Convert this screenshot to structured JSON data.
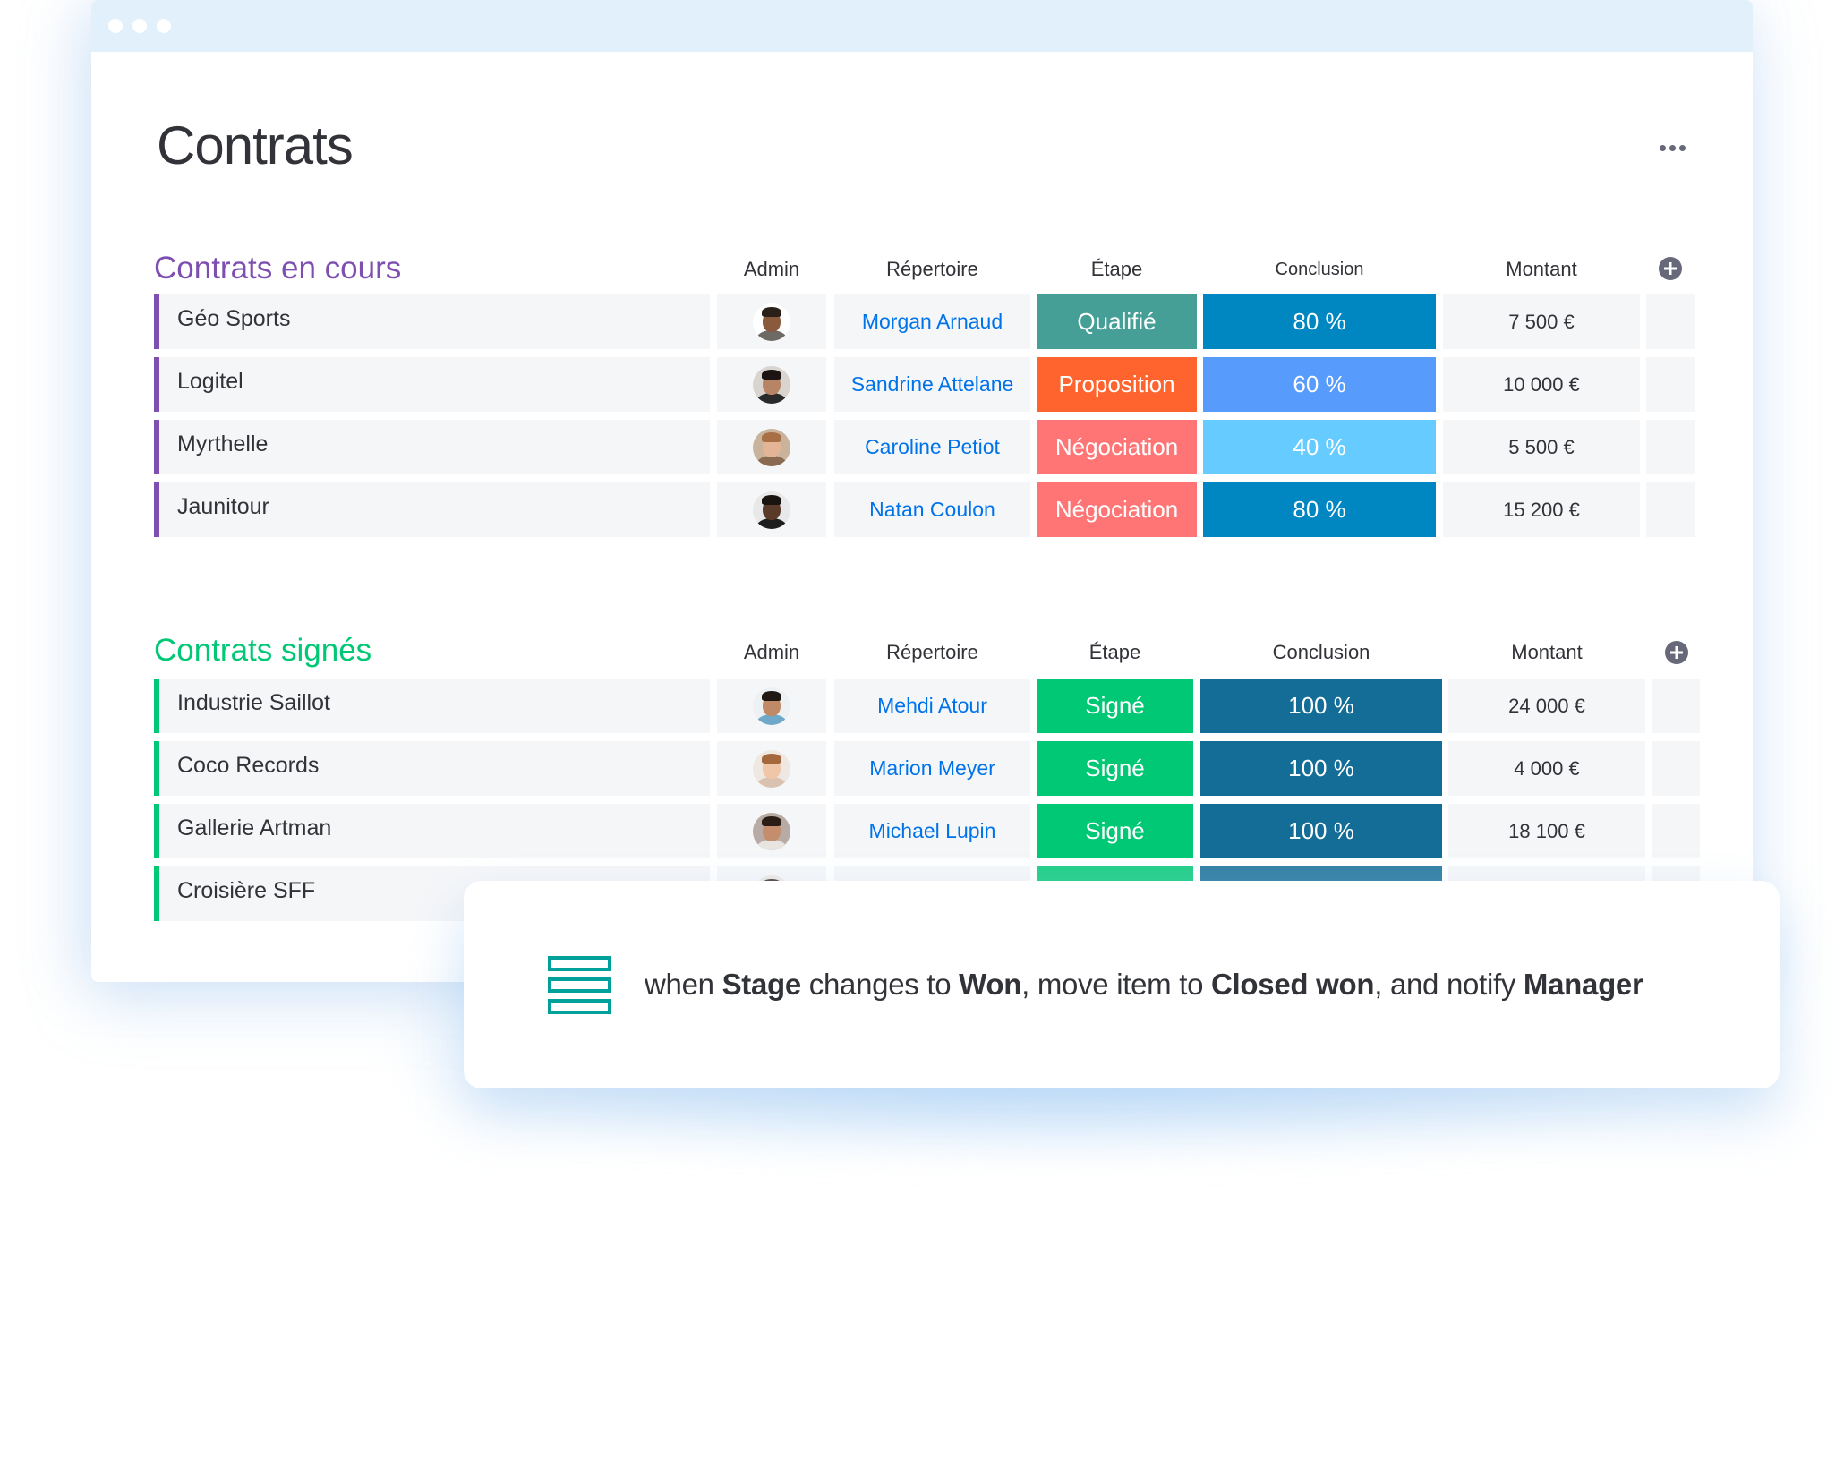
{
  "window": {
    "title": "Contrats",
    "menu_icon": "ellipsis-icon"
  },
  "groups": [
    {
      "title": "Contrats en cours",
      "color": "#7e4fb0",
      "headers": {
        "admin": "Admin",
        "repertoire": "Répertoire",
        "etape": "Étape",
        "conclusion": "Conclusion",
        "montant": "Montant"
      },
      "rows": [
        {
          "name": "Géo Sports",
          "admin_avatar": "avatar-man-1",
          "repertoire": "Morgan Arnaud",
          "etape": "Qualifié",
          "etape_color": "#459f96",
          "conclusion": "80 %",
          "conclusion_color": "#0086c0",
          "montant": "7 500 €"
        },
        {
          "name": "Logitel",
          "admin_avatar": "avatar-woman-1",
          "repertoire": "Sandrine Attelane",
          "etape": "Proposition",
          "etape_color": "#ff642e",
          "conclusion": "60 %",
          "conclusion_color": "#579bfc",
          "montant": "10 000 €"
        },
        {
          "name": "Myrthelle",
          "admin_avatar": "avatar-woman-2",
          "repertoire": "Caroline Petiot",
          "etape": "Négociation",
          "etape_color": "#ff7575",
          "conclusion": "40 %",
          "conclusion_color": "#66ccff",
          "montant": "5 500 €"
        },
        {
          "name": "Jaunitour",
          "admin_avatar": "avatar-man-2",
          "repertoire": "Natan Coulon",
          "etape": "Négociation",
          "etape_color": "#ff7575",
          "conclusion": "80 %",
          "conclusion_color": "#0086c0",
          "montant": "15 200 €"
        }
      ]
    },
    {
      "title": "Contrats signés",
      "color": "#00c875",
      "headers": {
        "admin": "Admin",
        "repertoire": "Répertoire",
        "etape": "Étape",
        "conclusion": "Conclusion",
        "montant": "Montant"
      },
      "rows": [
        {
          "name": "Industrie Saillot",
          "admin_avatar": "avatar-man-3",
          "repertoire": "Mehdi Atour",
          "etape": "Signé",
          "etape_color": "#00c875",
          "conclusion": "100 %",
          "conclusion_color": "#136d97",
          "montant": "24 000 €"
        },
        {
          "name": "Coco Records",
          "admin_avatar": "avatar-woman-3",
          "repertoire": "Marion Meyer",
          "etape": "Signé",
          "etape_color": "#00c875",
          "conclusion": "100 %",
          "conclusion_color": "#136d97",
          "montant": "4 000 €"
        },
        {
          "name": "Gallerie Artman",
          "admin_avatar": "avatar-man-4",
          "repertoire": "Michael Lupin",
          "etape": "Signé",
          "etape_color": "#00c875",
          "conclusion": "100 %",
          "conclusion_color": "#136d97",
          "montant": "18 100 €"
        },
        {
          "name": "Croisière SFF",
          "admin_avatar": "avatar-partial",
          "repertoire": "",
          "etape": "",
          "etape_color": "#00c875",
          "conclusion": "",
          "conclusion_color": "#136d97",
          "montant": ""
        }
      ]
    }
  ],
  "automation": {
    "icon": "rows-icon",
    "parts": [
      {
        "text": "when ",
        "bold": false
      },
      {
        "text": "Stage",
        "bold": true
      },
      {
        "text": " changes to ",
        "bold": false
      },
      {
        "text": "Won",
        "bold": true
      },
      {
        "text": ", move item to ",
        "bold": false
      },
      {
        "text": "Closed won",
        "bold": true
      },
      {
        "text": ", and notify ",
        "bold": false
      },
      {
        "text": "Manager",
        "bold": true
      }
    ]
  },
  "colors": {
    "titlebar": "#e1f0fb",
    "link": "#0073ea",
    "cell_bg": "#f5f6f8",
    "icon_gray": "#676879",
    "automation_icon": "#00a19a"
  }
}
